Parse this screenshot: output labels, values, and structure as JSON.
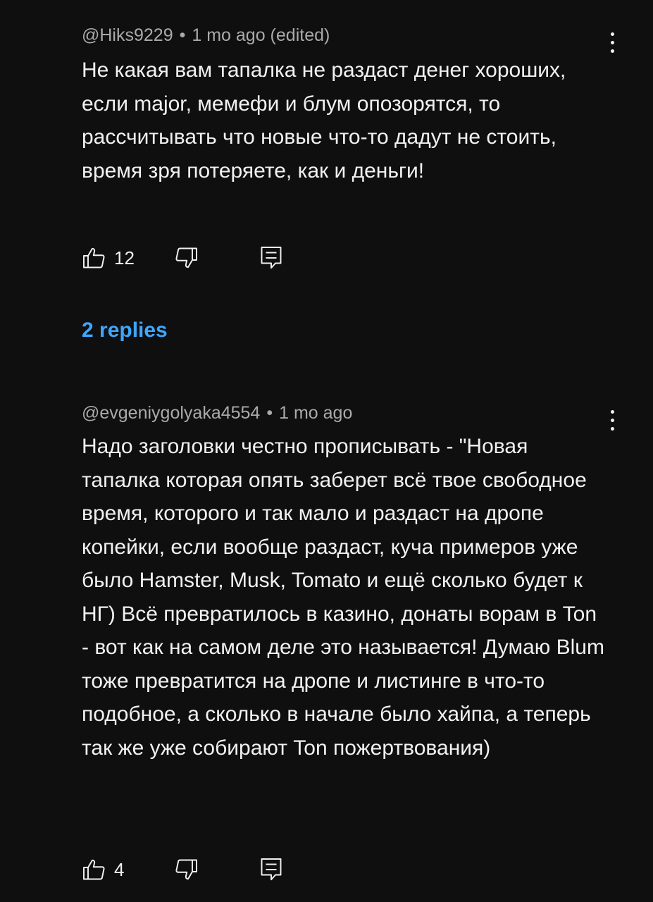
{
  "comments": [
    {
      "author": "@Hiks9229",
      "separator": "•",
      "time": "1 mo ago (edited)",
      "text": "Не какая вам тапалка не раздаст денег хороших, если major, мемефи и блум опозорятся, то рассчитывать что новые что-то дадут не стоить, время зря потеряете, как и деньги!",
      "likes": "12",
      "replies_link": "2 replies"
    },
    {
      "author": "@evgeniygolyaka4554",
      "separator": "•",
      "time": "1 mo ago",
      "text": "Надо заголовки честно прописывать - \"Новая тапалка которая опять заберет всё твое свободное время, которого и так мало и раздаст на дропе копейки, если вообще раздаст, куча примеров уже было Hamster, Musk, Tomato и ещё сколько будет к НГ) Всё превратилось в казино, донаты ворам в Ton - вот как на самом деле это называется! Думаю Blum тоже превратится на дропе и листинге в что-то подобное, а сколько в начале было хайпа, а теперь так же уже собирают Ton пожертвования)",
      "likes": "4"
    }
  ],
  "icons": {
    "like": "thumbs-up-icon",
    "dislike": "thumbs-down-icon",
    "reply": "reply-comment-icon",
    "menu": "more-vertical-icon"
  },
  "colors": {
    "background": "#0f0f0f",
    "text": "#f1f1f1",
    "meta": "#aaaaaa",
    "link": "#3ea6ff"
  }
}
